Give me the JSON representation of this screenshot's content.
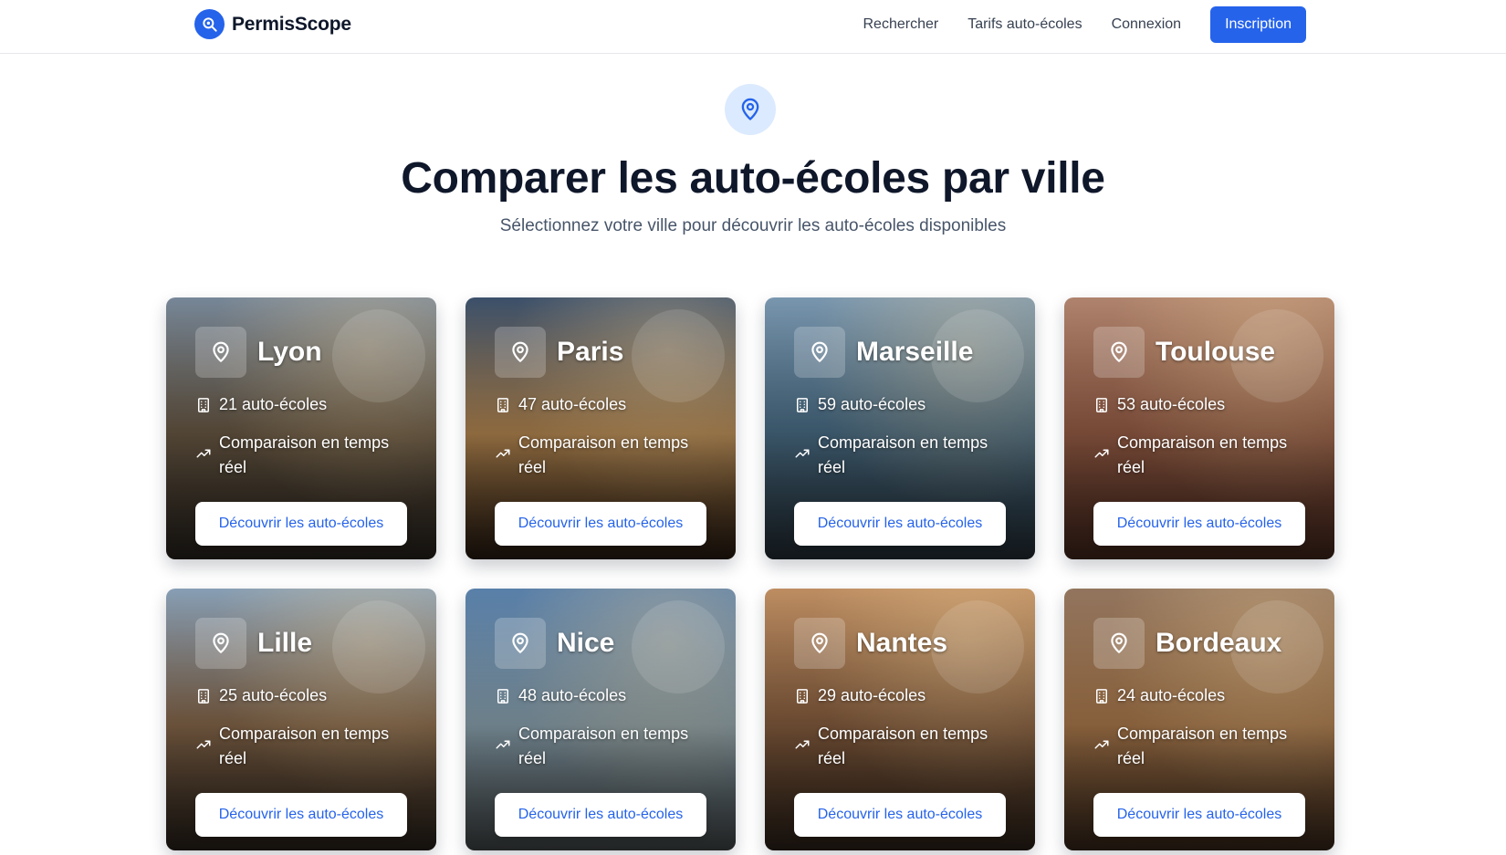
{
  "header": {
    "brand": "PermisScope",
    "nav": [
      "Rechercher",
      "Tarifs auto-écoles",
      "Connexion"
    ],
    "cta": "Inscription"
  },
  "hero": {
    "title": "Comparer les auto-écoles par ville",
    "subtitle": "Sélectionnez votre ville pour découvrir les auto-écoles disponibles"
  },
  "cards": [
    {
      "city": "Lyon",
      "count": "21 auto-écoles",
      "feature": "Comparaison en temps réel",
      "cta": "Découvrir les auto-écoles",
      "colors": [
        "#7d8ea0",
        "#6b5a45",
        "#2b2620"
      ]
    },
    {
      "city": "Paris",
      "count": "47 auto-écoles",
      "feature": "Comparaison en temps réel",
      "cta": "Découvrir les auto-écoles",
      "colors": [
        "#3e5470",
        "#b98a52",
        "#2a1c12"
      ]
    },
    {
      "city": "Marseille",
      "count": "59 auto-écoles",
      "feature": "Comparaison en temps réel",
      "cta": "Découvrir les auto-écoles",
      "colors": [
        "#7f9eb8",
        "#4b6f88",
        "#27323a"
      ]
    },
    {
      "city": "Toulouse",
      "count": "53 auto-écoles",
      "feature": "Comparaison en temps réel",
      "cta": "Découvrir les auto-écoles",
      "colors": [
        "#b88a73",
        "#9a5f47",
        "#4a2a1f"
      ]
    },
    {
      "city": "Lille",
      "count": "25 auto-écoles",
      "feature": "Comparaison en temps réel",
      "cta": "Découvrir les auto-écoles",
      "colors": [
        "#8ea7bf",
        "#8a6a4c",
        "#2c241d"
      ]
    },
    {
      "city": "Nice",
      "count": "48 auto-écoles",
      "feature": "Comparaison en temps réel",
      "cta": "Découvrir les auto-écoles",
      "colors": [
        "#5d86b2",
        "#8fa7b4",
        "#4a4f50"
      ]
    },
    {
      "city": "Nantes",
      "count": "29 auto-écoles",
      "feature": "Comparaison en temps réel",
      "cta": "Découvrir les auto-écoles",
      "colors": [
        "#c89567",
        "#8a6040",
        "#30241b"
      ]
    },
    {
      "city": "Bordeaux",
      "count": "24 auto-écoles",
      "feature": "Comparaison en temps réel",
      "cta": "Découvrir les auto-écoles",
      "colors": [
        "#9a7b63",
        "#b07d4e",
        "#3c2a1d"
      ]
    }
  ]
}
